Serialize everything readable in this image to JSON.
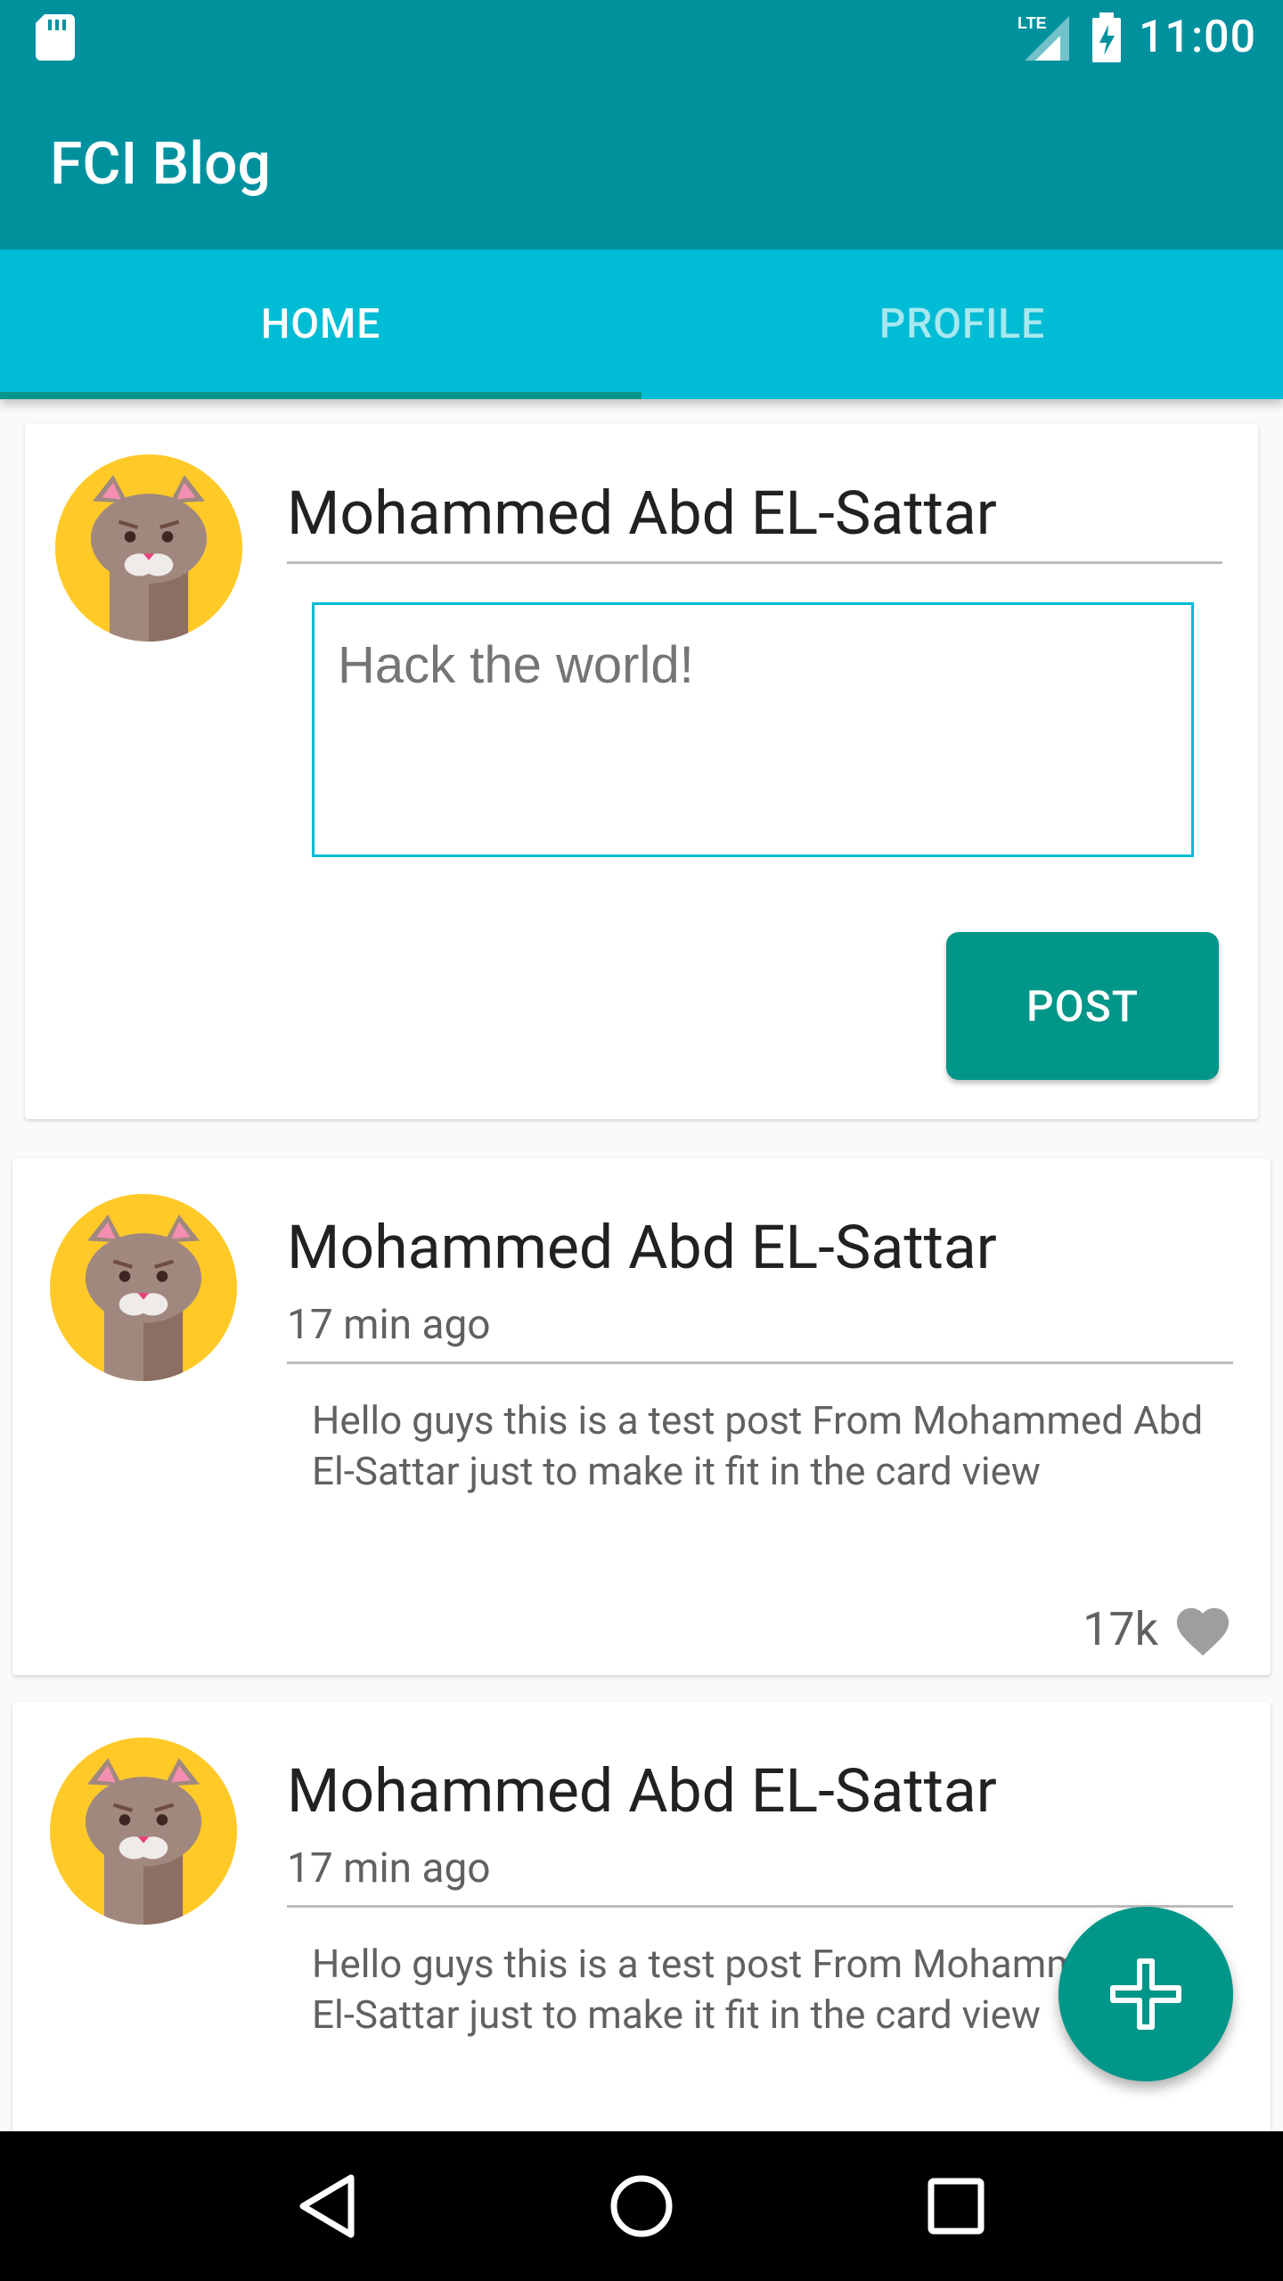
{
  "status_bar": {
    "time": "11:00",
    "network_label": "LTE",
    "icons": [
      "sd-card-icon",
      "signal-icon",
      "battery-charging-icon"
    ]
  },
  "app_bar": {
    "title": "FCI Blog"
  },
  "tabs": [
    {
      "label": "HOME",
      "selected": true
    },
    {
      "label": "PROFILE",
      "selected": false
    }
  ],
  "composer": {
    "author": "Mohammed Abd EL-Sattar",
    "placeholder": "Hack the world!",
    "post_label": "POST"
  },
  "posts": [
    {
      "author": "Mohammed Abd EL-Sattar",
      "time": "17 min ago",
      "text": "Hello guys this is a test post From Mohammed Abd El-Sattar just to make it fit in the card view",
      "likes": "17k"
    },
    {
      "author": "Mohammed Abd EL-Sattar",
      "time": "17 min ago",
      "text": "Hello guys this is a test post From Mohammed Abd El-Sattar just to make it fit in the card view"
    }
  ],
  "colors": {
    "primary_dark": "#00919f",
    "tab_bar": "#00bcd4",
    "accent": "#009688",
    "avatar_bg": "#ffca28"
  }
}
